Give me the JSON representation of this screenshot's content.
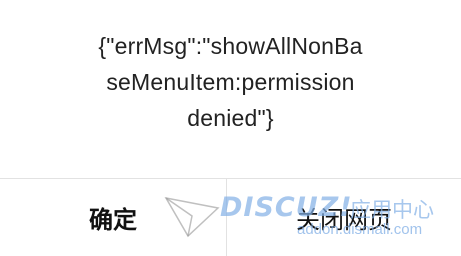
{
  "dialog": {
    "message_lines": [
      "{\"errMsg\":\"showAllNonBa",
      "seMenuItem:permission",
      "denied\"}"
    ],
    "ok_label": "确定",
    "close_label": "关闭网页"
  },
  "watermark": {
    "brand": "DISCUZ!",
    "cn_text": "应用中心",
    "url": "addon.dismall.com"
  },
  "colors": {
    "text": "#222222",
    "divider": "#e2e2e2",
    "watermark": "#82afe6"
  }
}
